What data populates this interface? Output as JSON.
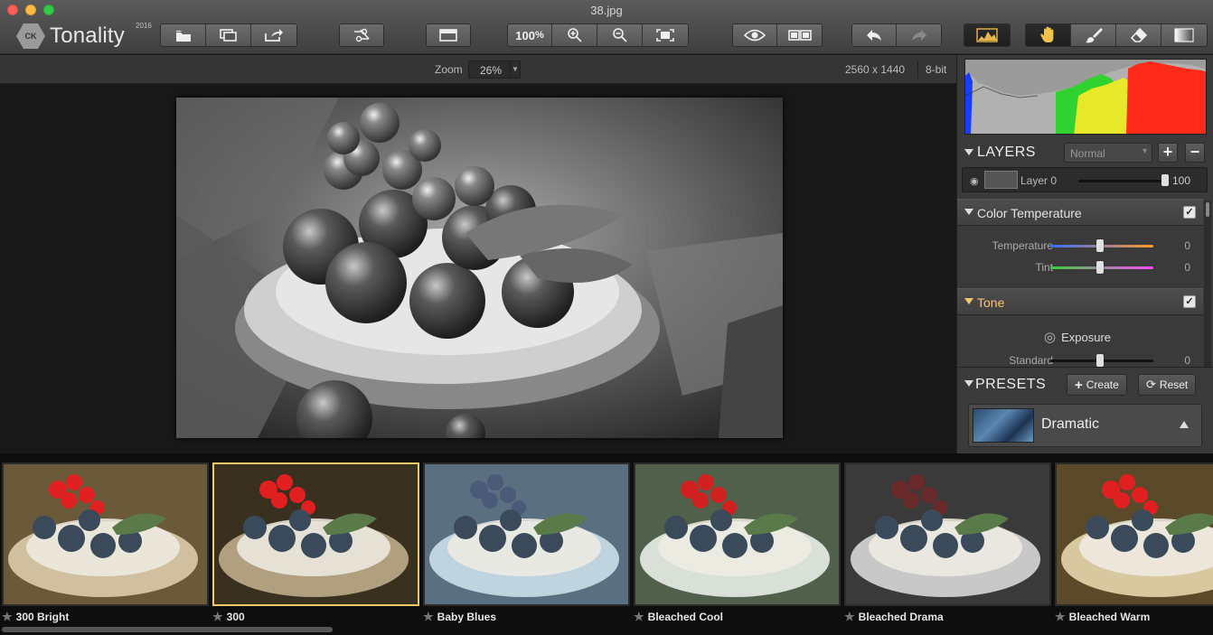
{
  "window": {
    "title": "38.jpg"
  },
  "app": {
    "name": "Tonality",
    "logo_badge": "CK",
    "year": "2016"
  },
  "toolbar": {
    "zoom_100_label": "100",
    "zoom_100_unit": "%",
    "icons": [
      "open-icon",
      "batch-icon",
      "export-icon",
      "crop-icon",
      "layout-icon",
      "zoom-100",
      "zoom-in-icon",
      "zoom-out-icon",
      "fit-screen-icon",
      "preview-eye-icon",
      "compare-icon",
      "undo-icon",
      "redo-icon",
      "histogram-toggle-icon",
      "hand-tool-icon",
      "brush-tool-icon",
      "eraser-tool-icon",
      "gradient-tool-icon"
    ]
  },
  "subbar": {
    "zoom_label": "Zoom",
    "zoom_value": "26%",
    "dimensions": "2560 x 1440",
    "bit_depth": "8-bit"
  },
  "layers": {
    "title": "LAYERS",
    "blend_mode": "Normal",
    "add_label": "+",
    "remove_label": "−",
    "items": [
      {
        "name": "Layer 0",
        "opacity": "100",
        "opacity_fraction": 1.0
      }
    ]
  },
  "color_temperature": {
    "title": "Color Temperature",
    "enabled": true,
    "sliders": [
      {
        "label": "Temperature",
        "value": "0",
        "level": 0.5
      },
      {
        "label": "Tint",
        "value": "0",
        "level": 0.5
      }
    ]
  },
  "tone": {
    "title": "Tone",
    "enabled": true,
    "subsection": "Exposure",
    "sliders": [
      {
        "label": "Standard",
        "value": "0",
        "level": 0.5
      }
    ]
  },
  "presets": {
    "title": "PRESETS",
    "create_label": "Create",
    "reset_label": "Reset",
    "selected": "Dramatic"
  },
  "filmstrip": {
    "tiles": [
      {
        "name": "300 Bright",
        "selected": false
      },
      {
        "name": "300",
        "selected": true
      },
      {
        "name": "Baby Blues",
        "selected": false
      },
      {
        "name": "Bleached Cool",
        "selected": false
      },
      {
        "name": "Bleached Drama",
        "selected": false
      },
      {
        "name": "Bleached Warm",
        "selected": false
      }
    ]
  },
  "colors": {
    "accent_selected": "#f1c96a",
    "tone_title": "#f4c86a",
    "temp_track": "#3a6cff→#ff9a2a",
    "tint_track": "#3ad03a→#ff4aff"
  }
}
